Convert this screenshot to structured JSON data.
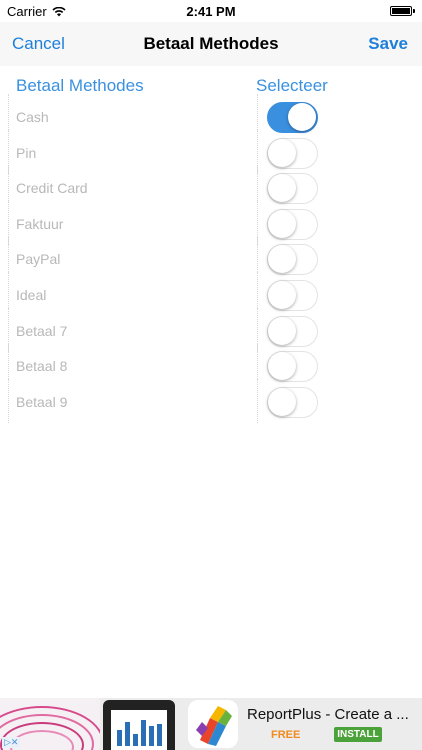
{
  "status_bar": {
    "carrier": "Carrier",
    "time": "2:41 PM",
    "wifi_icon": "wifi-icon",
    "battery_icon": "battery-icon"
  },
  "nav": {
    "cancel_label": "Cancel",
    "title": "Betaal Methodes",
    "save_label": "Save"
  },
  "table": {
    "header_left": "Betaal Methodes",
    "header_right": "Selecteer",
    "accent_color": "#3a8fde",
    "rows": [
      {
        "label": "Cash",
        "selected": true
      },
      {
        "label": "Pin",
        "selected": false
      },
      {
        "label": "Credit Card",
        "selected": false
      },
      {
        "label": "Faktuur",
        "selected": false
      },
      {
        "label": "PayPal",
        "selected": false
      },
      {
        "label": "Ideal",
        "selected": false
      },
      {
        "label": "Betaal 7",
        "selected": false
      },
      {
        "label": "Betaal 8",
        "selected": false
      },
      {
        "label": "Betaal 9",
        "selected": false
      }
    ]
  },
  "ad": {
    "app_name": "ReportPlus - Create a ...",
    "price": "FREE",
    "install_label": "INSTALL",
    "adchoices_icon": "adchoices-icon"
  }
}
